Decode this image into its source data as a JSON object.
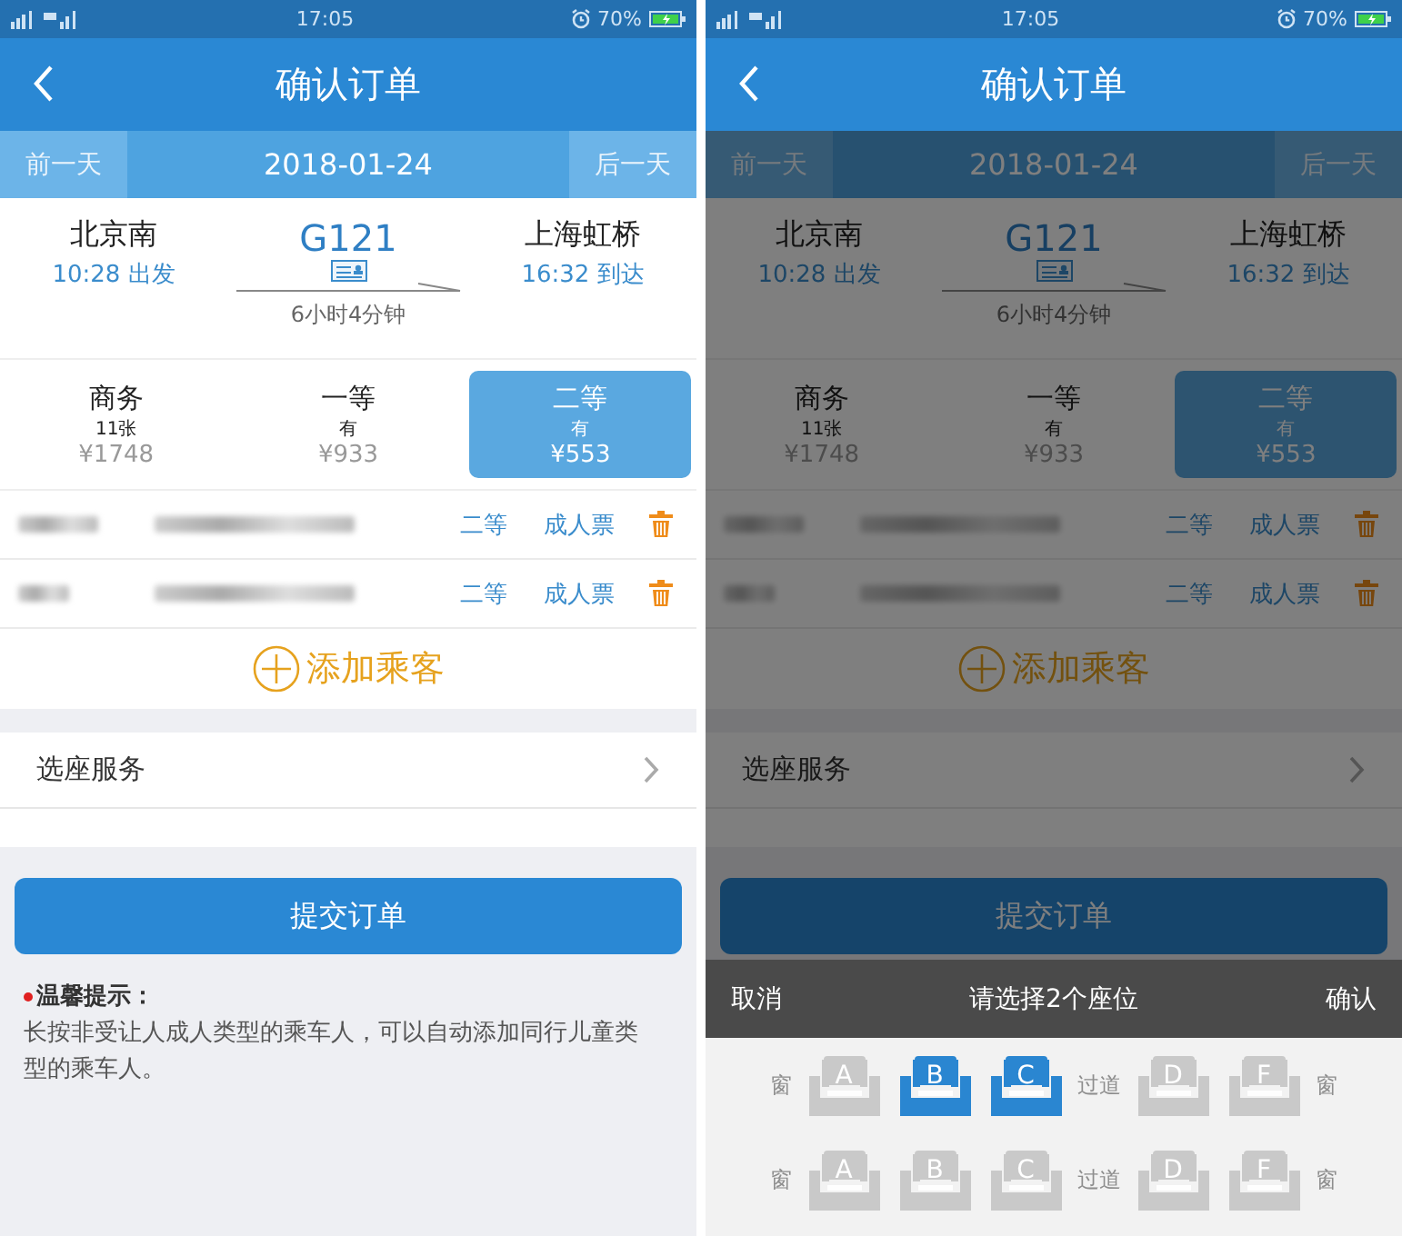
{
  "screens": [
    {
      "status_bar": {
        "time": "17:05",
        "battery": "70%"
      },
      "header": {
        "title": "确认订单"
      },
      "date_bar": {
        "prev": "前一天",
        "date": "2018-01-24",
        "next": "后一天"
      },
      "train": {
        "from": {
          "station": "北京南",
          "time": "10:28 出发"
        },
        "number": "G121",
        "duration": "6小时4分钟",
        "to": {
          "station": "上海虹桥",
          "time": "16:32 到达"
        }
      },
      "seat_classes": [
        {
          "name": "商务",
          "availability": "11张",
          "price": "¥1748",
          "selected": false
        },
        {
          "name": "一等",
          "availability": "有",
          "price": "¥933",
          "selected": false
        },
        {
          "name": "二等",
          "availability": "有",
          "price": "¥553",
          "selected": true
        }
      ],
      "passengers": [
        {
          "seat_class": "二等",
          "ticket_type": "成人票"
        },
        {
          "seat_class": "二等",
          "ticket_type": "成人票"
        }
      ],
      "add_passenger": "添加乘客",
      "seat_service": "选座服务",
      "submit": "提交订单",
      "tips": {
        "title": "温馨提示：",
        "text": "长按非受让人成人类型的乘车人，可以自动添加同行儿童类型的乘车人。"
      },
      "dimmed": false
    },
    {
      "status_bar": {
        "time": "17:05",
        "battery": "70%"
      },
      "header": {
        "title": "确认订单"
      },
      "date_bar": {
        "prev": "前一天",
        "date": "2018-01-24",
        "next": "后一天"
      },
      "train": {
        "from": {
          "station": "北京南",
          "time": "10:28 出发"
        },
        "number": "G121",
        "duration": "6小时4分钟",
        "to": {
          "station": "上海虹桥",
          "time": "16:32 到达"
        }
      },
      "seat_classes": [
        {
          "name": "商务",
          "availability": "11张",
          "price": "¥1748",
          "selected": false
        },
        {
          "name": "一等",
          "availability": "有",
          "price": "¥933",
          "selected": false
        },
        {
          "name": "二等",
          "availability": "有",
          "price": "¥553",
          "selected": true
        }
      ],
      "passengers": [
        {
          "seat_class": "二等",
          "ticket_type": "成人票"
        },
        {
          "seat_class": "二等",
          "ticket_type": "成人票"
        }
      ],
      "add_passenger": "添加乘客",
      "seat_service": "选座服务",
      "submit": "提交订单",
      "dimmed": true,
      "seat_picker": {
        "cancel": "取消",
        "title": "请选择2个座位",
        "confirm": "确认",
        "rows": [
          {
            "items": [
              {
                "kind": "label",
                "text": "窗"
              },
              {
                "kind": "seat",
                "letter": "A",
                "selected": false
              },
              {
                "kind": "seat",
                "letter": "B",
                "selected": true
              },
              {
                "kind": "seat",
                "letter": "C",
                "selected": true
              },
              {
                "kind": "label",
                "text": "过道"
              },
              {
                "kind": "seat",
                "letter": "D",
                "selected": false
              },
              {
                "kind": "seat",
                "letter": "F",
                "selected": false
              },
              {
                "kind": "label",
                "text": "窗"
              }
            ]
          },
          {
            "items": [
              {
                "kind": "label",
                "text": "窗"
              },
              {
                "kind": "seat",
                "letter": "A",
                "selected": false
              },
              {
                "kind": "seat",
                "letter": "B",
                "selected": false
              },
              {
                "kind": "seat",
                "letter": "C",
                "selected": false
              },
              {
                "kind": "label",
                "text": "过道"
              },
              {
                "kind": "seat",
                "letter": "D",
                "selected": false
              },
              {
                "kind": "seat",
                "letter": "F",
                "selected": false
              },
              {
                "kind": "label",
                "text": "窗"
              }
            ]
          }
        ]
      }
    }
  ]
}
